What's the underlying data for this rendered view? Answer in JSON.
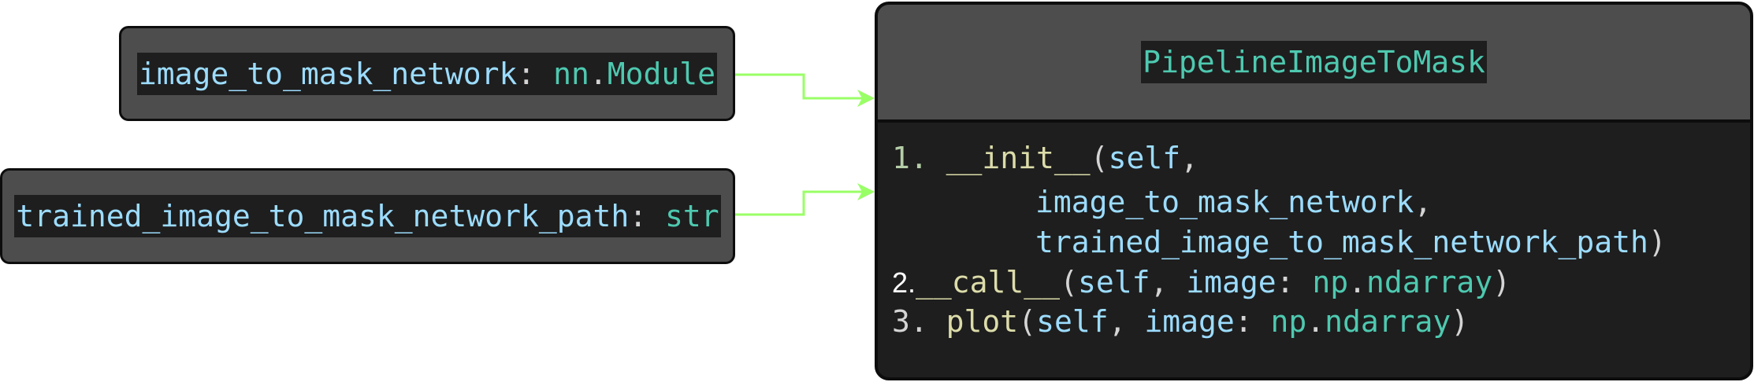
{
  "inputs": [
    {
      "name": "image_to_mask_network",
      "sep": ": ",
      "type_mod": "nn",
      "dot": ".",
      "type": "Module"
    },
    {
      "name": "trained_image_to_mask_network_path",
      "sep": ": ",
      "type": "str"
    }
  ],
  "class_box": {
    "title": "PipelineImageToMask",
    "methods": {
      "m1": {
        "num": "1.",
        "gap": " ",
        "name": "__init__",
        "open": "(",
        "self": "self",
        "comma": ","
      },
      "m1_arg1": {
        "name": "image_to_mask_network",
        "comma": ","
      },
      "m1_arg2": {
        "name": "trained_image_to_mask_network_path",
        "close": ")"
      },
      "m2": {
        "num": "2.",
        "name": "__call__",
        "open": "(",
        "self": "self",
        "comma": ", ",
        "arg": "image",
        "colon": ": ",
        "type_mod": "np",
        "dot": ".",
        "type": "ndarray",
        "close": ")"
      },
      "m3": {
        "num": "3.",
        "gap": " ",
        "name": "plot",
        "open": "(",
        "self": "self",
        "comma": ", ",
        "arg": "image",
        "colon": ": ",
        "type_mod": "np",
        "dot": ".",
        "type": "ndarray",
        "close": ")"
      }
    }
  },
  "colors": {
    "variable": "#9cdcfe",
    "type": "#4ec9b0",
    "function": "#dcdcaa",
    "punctuation": "#d4d4d4",
    "box_fill": "#4d4d4d",
    "code_bg": "#1e1e1e",
    "connector": "#99ff66"
  }
}
